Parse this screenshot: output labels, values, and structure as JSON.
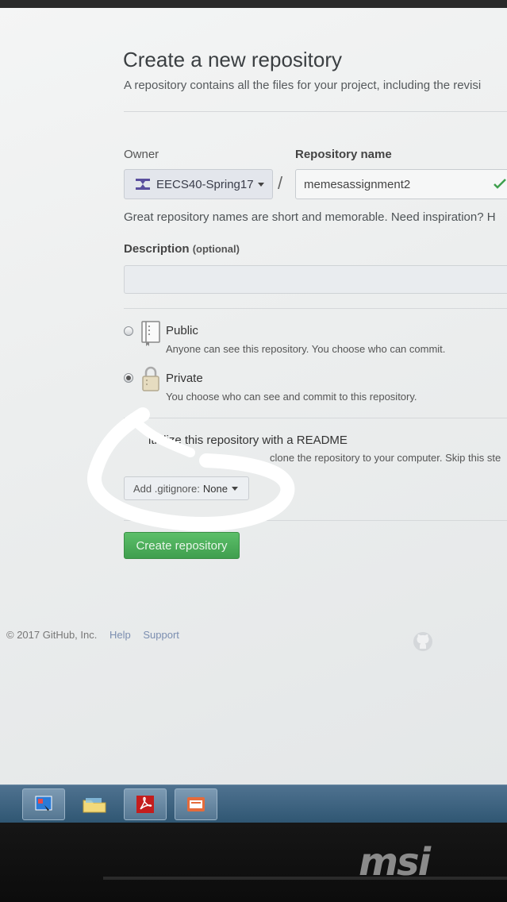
{
  "page": {
    "title": "Create a new repository",
    "subtitle": "A repository contains all the files for your project, including the revisi"
  },
  "form": {
    "owner_label": "Owner",
    "owner_value": "EECS40-Spring17",
    "slash": "/",
    "repo_label": "Repository name",
    "repo_value": "memesassignment2",
    "hint": "Great repository names are short and memorable. Need inspiration? H",
    "description_label": "Description",
    "description_optional": "(optional)",
    "description_value": "",
    "visibility": {
      "public_title": "Public",
      "public_desc": "Anyone can see this repository. You choose who can commit.",
      "private_title": "Private",
      "private_desc": "You choose who can see and commit to this repository.",
      "selected": "private"
    },
    "readme_label": "itialize this repository with a README",
    "readme_hint": "clone the repository to your computer. Skip this ste",
    "gitignore_label": "Add .gitignore:",
    "gitignore_value": "None",
    "submit_label": "Create repository"
  },
  "footer": {
    "copyright": "© 2017 GitHub, Inc.",
    "help": "Help",
    "support": "Support"
  },
  "device": {
    "brand": "msi"
  },
  "colors": {
    "accent_green": "#4cb05a",
    "taskbar": "#3d6482",
    "annotation": "#ffffff"
  },
  "icons": [
    "owner-org-icon",
    "check-icon",
    "book-icon",
    "lock-icon",
    "octocat-icon",
    "taskbar-app-icon",
    "folder-icon",
    "pdf-icon",
    "window-icon"
  ]
}
